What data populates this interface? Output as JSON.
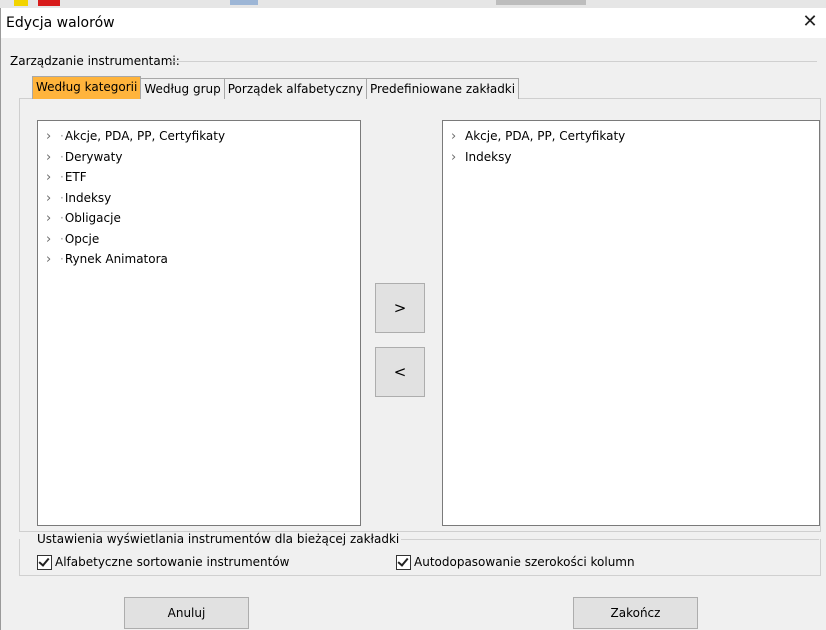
{
  "window": {
    "title": "Edycja walorów",
    "close_glyph": "✕"
  },
  "management": {
    "label": "Zarządzanie instrumentami:"
  },
  "tabs": [
    {
      "label": "Według kategorii",
      "active": true
    },
    {
      "label": "Według grup",
      "active": false
    },
    {
      "label": "Porządek alfabetyczny",
      "active": false
    },
    {
      "label": "Predefiniowane zakładki",
      "active": false
    }
  ],
  "left_tree": {
    "items": [
      {
        "label": "Akcje, PDA, PP, Certyfikaty"
      },
      {
        "label": "Derywaty"
      },
      {
        "label": "ETF"
      },
      {
        "label": "Indeksy"
      },
      {
        "label": "Obligacje"
      },
      {
        "label": "Opcje"
      },
      {
        "label": "Rynek Animatora"
      }
    ]
  },
  "right_tree": {
    "items": [
      {
        "label": "Akcje, PDA, PP, Certyfikaty"
      },
      {
        "label": "Indeksy"
      }
    ]
  },
  "move_buttons": {
    "right": ">",
    "left": "<"
  },
  "display_settings": {
    "label": "Ustawienia wyświetlania instrumentów dla bieżącej zakładki",
    "alpha_sort": {
      "label": "Alfabetyczne sortowanie instrumentów",
      "checked": true
    },
    "auto_fit": {
      "label": "Autodopasowanie szerokości kolumn",
      "checked": true
    }
  },
  "buttons": {
    "cancel": "Anuluj",
    "finish": "Zakończ"
  },
  "colors": {
    "active_tab": "#ffb43c",
    "button_bg": "#e1e1e1"
  }
}
